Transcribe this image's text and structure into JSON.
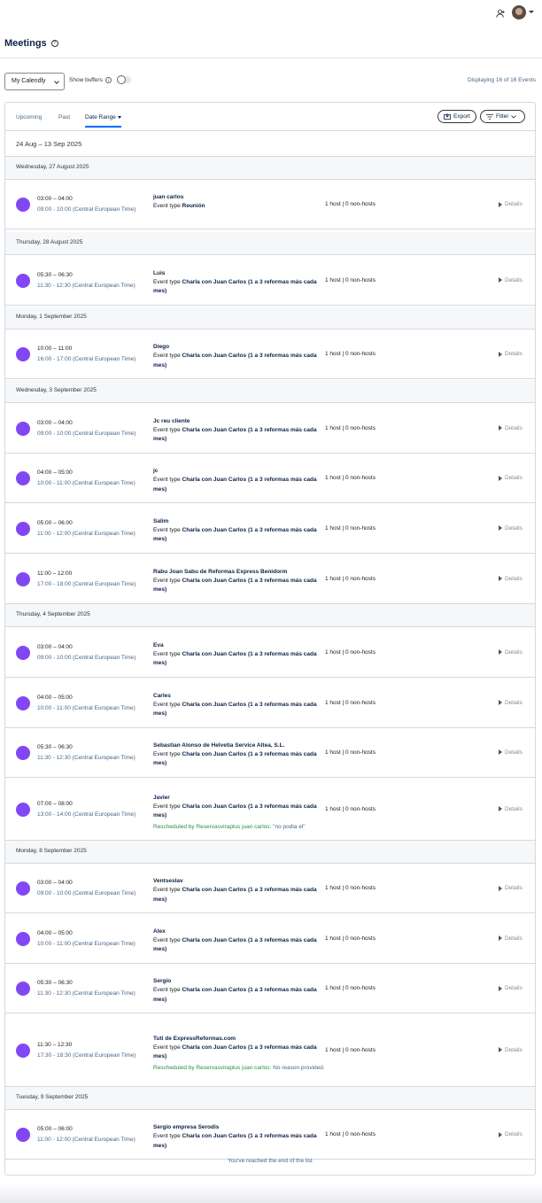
{
  "page": {
    "title": "Meetings"
  },
  "filters": {
    "calendly_select": "My Calendly",
    "show_buffers": "Show buffers",
    "displaying": "Displaying 16 of 16 Events"
  },
  "tabs": [
    {
      "label": "Upcoming"
    },
    {
      "label": "Past"
    },
    {
      "label": "Date Range",
      "active": true
    }
  ],
  "actions": {
    "export": "Export",
    "filter": "Filter"
  },
  "date_range": "24 Aug – 13 Sep 2025",
  "days": [
    {
      "label": "Wednesday, 27 August 2025",
      "events": [
        {
          "time": "03:00 – 04:00",
          "local": "09:00 - 10:00 (Central European Time)",
          "name": "juan carlos",
          "type_prefix": "Event type",
          "type": "Reunión",
          "hosts": "1 host | 0 non-hosts",
          "details": "Details"
        }
      ]
    },
    {
      "label": "Thursday, 28 August 2025",
      "events": [
        {
          "time": "05:30 – 06:30",
          "local": "11:30 - 12:30 (Central European Time)",
          "name": "Luis",
          "type_prefix": "Event type",
          "type": "Charla con Juan Carlos (1 a 3 reformas más cada mes)",
          "hosts": "1 host | 0 non-hosts",
          "details": "Details"
        }
      ]
    },
    {
      "label": "Monday, 1 September 2025",
      "events": [
        {
          "time": "10:00 – 11:00",
          "local": "16:00 - 17:00 (Central European Time)",
          "name": "Diego",
          "type_prefix": "Event type",
          "type": "Charla con Juan Carlos (1 a 3 reformas más cada mes)",
          "hosts": "1 host | 0 non-hosts",
          "details": "Details"
        }
      ]
    },
    {
      "label": "Wednesday, 3 September 2025",
      "events": [
        {
          "time": "03:00 – 04:00",
          "local": "09:00 - 10:00 (Central European Time)",
          "name": "Jc reu cliente",
          "type_prefix": "Event type",
          "type": "Charla con Juan Carlos (1 a 3 reformas más cada mes)",
          "hosts": "1 host | 0 non-hosts",
          "details": "Details"
        },
        {
          "time": "04:00 – 05:00",
          "local": "10:00 - 11:00 (Central European Time)",
          "name": "jc",
          "type_prefix": "Event type",
          "type": "Charla con Juan Carlos (1 a 3 reformas más cada mes)",
          "hosts": "1 host | 0 non-hosts",
          "details": "Details"
        },
        {
          "time": "05:00 – 06:00",
          "local": "11:00 - 12:00 (Central European Time)",
          "name": "Salim",
          "type_prefix": "Event type",
          "type": "Charla con Juan Carlos (1 a 3 reformas más cada mes)",
          "hosts": "1 host | 0 non-hosts",
          "details": "Details"
        },
        {
          "time": "11:00 – 12:00",
          "local": "17:00 - 18:00 (Central European Time)",
          "name": "Rabu Joan Sabu de Reformas Express Benidorm",
          "type_prefix": "Event type",
          "type": "Charla con Juan Carlos (1 a 3 reformas más cada mes)",
          "hosts": "1 host | 0 non-hosts",
          "details": "Details"
        }
      ]
    },
    {
      "label": "Thursday, 4 September 2025",
      "events": [
        {
          "time": "03:00 – 04:00",
          "local": "09:00 - 10:00 (Central European Time)",
          "name": "Eva",
          "type_prefix": "Event type",
          "type": "Charla con Juan Carlos (1 a 3 reformas más cada mes)",
          "hosts": "1 host | 0 non-hosts",
          "details": "Details"
        },
        {
          "time": "04:00 – 05:00",
          "local": "10:00 - 11:00 (Central European Time)",
          "name": "Carles",
          "type_prefix": "Event type",
          "type": "Charla con Juan Carlos (1 a 3 reformas más cada mes)",
          "hosts": "1 host | 0 non-hosts",
          "details": "Details"
        },
        {
          "time": "05:30 – 06:30",
          "local": "11:30 - 12:30 (Central European Time)",
          "name": "Sebastian Alonso de Helvetia Service Altea, S.L.",
          "type_prefix": "Event type",
          "type": "Charla con Juan Carlos (1 a 3 reformas más cada mes)",
          "hosts": "1 host | 0 non-hosts",
          "details": "Details"
        },
        {
          "time": "07:00 – 08:00",
          "local": "13:00 - 14:00 (Central European Time)",
          "name": "Javier",
          "type_prefix": "Event type",
          "type": "Charla con Juan Carlos (1 a 3 reformas más cada mes)",
          "hosts": "1 host | 0 non-hosts",
          "details": "Details",
          "rescheduled": "Rescheduled by Reservasviraplus juan carlos:",
          "note": "\"no podia el\""
        }
      ]
    },
    {
      "label": "Monday, 8 September 2025",
      "events": [
        {
          "time": "03:00 – 04:00",
          "local": "09:00 - 10:00 (Central European Time)",
          "name": "Ventseslav",
          "type_prefix": "Event type",
          "type": "Charla con Juan Carlos (1 a 3 reformas más cada mes)",
          "hosts": "1 host | 0 non-hosts",
          "details": "Details"
        },
        {
          "time": "04:00 – 05:00",
          "local": "10:00 - 11:00 (Central European Time)",
          "name": "Alex",
          "type_prefix": "Event type",
          "type": "Charla con Juan Carlos (1 a 3 reformas más cada mes)",
          "hosts": "1 host | 0 non-hosts",
          "details": "Details"
        },
        {
          "time": "05:30 – 06:30",
          "local": "11:30 - 12:30 (Central European Time)",
          "name": "Sergio",
          "type_prefix": "Event type",
          "type": "Charla con Juan Carlos (1 a 3 reformas más cada mes)",
          "hosts": "1 host | 0 non-hosts",
          "details": "Details"
        },
        {
          "time": "11:30 – 12:30",
          "local": "17:30 - 18:30 (Central European Time)",
          "name": "Tuti de ExpressReformas.com",
          "type_prefix": "Event type",
          "type": "Charla con Juan Carlos (1 a 3 reformas más cada mes)",
          "hosts": "1 host | 0 non-hosts",
          "details": "Details",
          "rescheduled": "Rescheduled by Reservasviraplus juan carlos:",
          "note": "No reason provided."
        }
      ]
    },
    {
      "label": "Tuesday, 9 September 2025",
      "events": [
        {
          "time": "05:00 – 06:00",
          "local": "11:00 - 12:00 (Central European Time)",
          "name": "Sergio empresa Serodis",
          "type_prefix": "Event type",
          "type": "Charla con Juan Carlos (1 a 3 reformas más cada mes)",
          "hosts": "1 host | 0 non-hosts",
          "details": "Details"
        }
      ]
    }
  ],
  "end_message": "You've reached the end of the list",
  "colors": {
    "event_dot": "#8247f5",
    "accent": "#006bff"
  }
}
